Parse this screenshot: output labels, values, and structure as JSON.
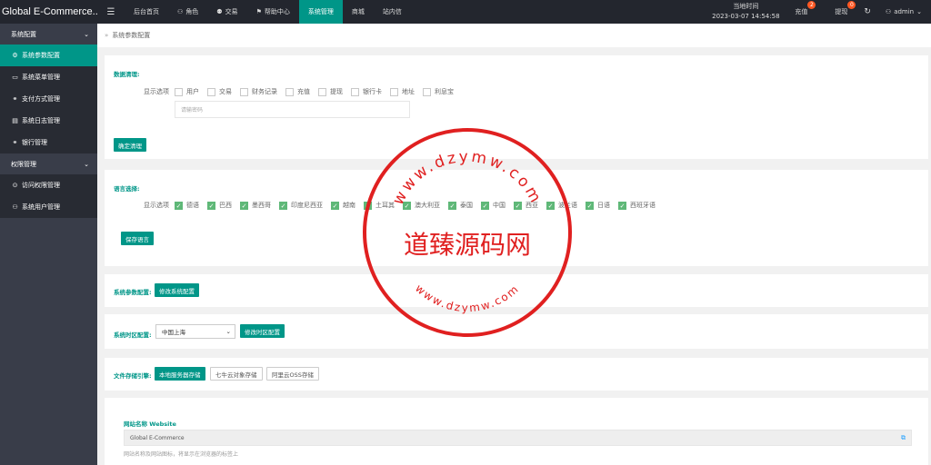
{
  "header": {
    "brand": "Global E-Commerce...",
    "menu_icon": "menu-icon",
    "nav": [
      {
        "label": "后台首页",
        "icon": ""
      },
      {
        "label": "角色",
        "icon": "user-icon"
      },
      {
        "label": "交易",
        "icon": "users-icon"
      },
      {
        "label": "帮助中心",
        "icon": "flag-icon"
      },
      {
        "label": "系统管理",
        "icon": ""
      },
      {
        "label": "商城",
        "icon": ""
      },
      {
        "label": "站内信",
        "icon": ""
      }
    ],
    "clock_label": "当地时间",
    "clock_value": "2023-03-07 14:54:58",
    "recharge_label": "充值",
    "recharge_badge": "2",
    "withdraw_label": "提现",
    "withdraw_badge": "0",
    "user": "admin"
  },
  "sidebar": {
    "group1": "系统配置",
    "items1": [
      "系统参数配置",
      "系统菜单管理",
      "支付方式管理",
      "系统日志管理",
      "银行管理"
    ],
    "group2": "权限管理",
    "items2": [
      "访问权限管理",
      "系统用户管理"
    ]
  },
  "breadcrumb": "系统参数配置",
  "clear": {
    "title": "数据清理:",
    "options_label": "显示选项",
    "options": [
      "用户",
      "交易",
      "财务记录",
      "充值",
      "提现",
      "银行卡",
      "地址",
      "利息宝"
    ],
    "password_placeholder": "请输密码",
    "button": "确定清理"
  },
  "language": {
    "title": "语言选择:",
    "options_label": "显示选项",
    "options": [
      "德语",
      "巴西",
      "墨西哥",
      "印度尼西亚",
      "越南",
      "土耳其",
      "澳大利亚",
      "泰国",
      "中国",
      "西亚",
      "波兰语",
      "日语",
      "西班牙语"
    ],
    "button": "保存语言"
  },
  "sys_params": {
    "title": "系统参数配置:",
    "button": "修改系统配置"
  },
  "timezone": {
    "title": "系统时区配置:",
    "selected": "中国上海",
    "button": "修改时区配置"
  },
  "storage": {
    "title": "文件存储引擎:",
    "options": [
      "本地服务器存储",
      "七牛云对象存储",
      "阿里云OSS存储"
    ]
  },
  "website": {
    "title": "网站名称 Website",
    "value": "Global E-Commerce",
    "hint": "网站名称及网站图标，将显示在浏览器的标签上"
  },
  "watermark": {
    "center": "道臻源码网",
    "top_arc": "www.dzymw.com",
    "bottom_arc": "www.dzymw.com",
    "color": "#e02020"
  }
}
